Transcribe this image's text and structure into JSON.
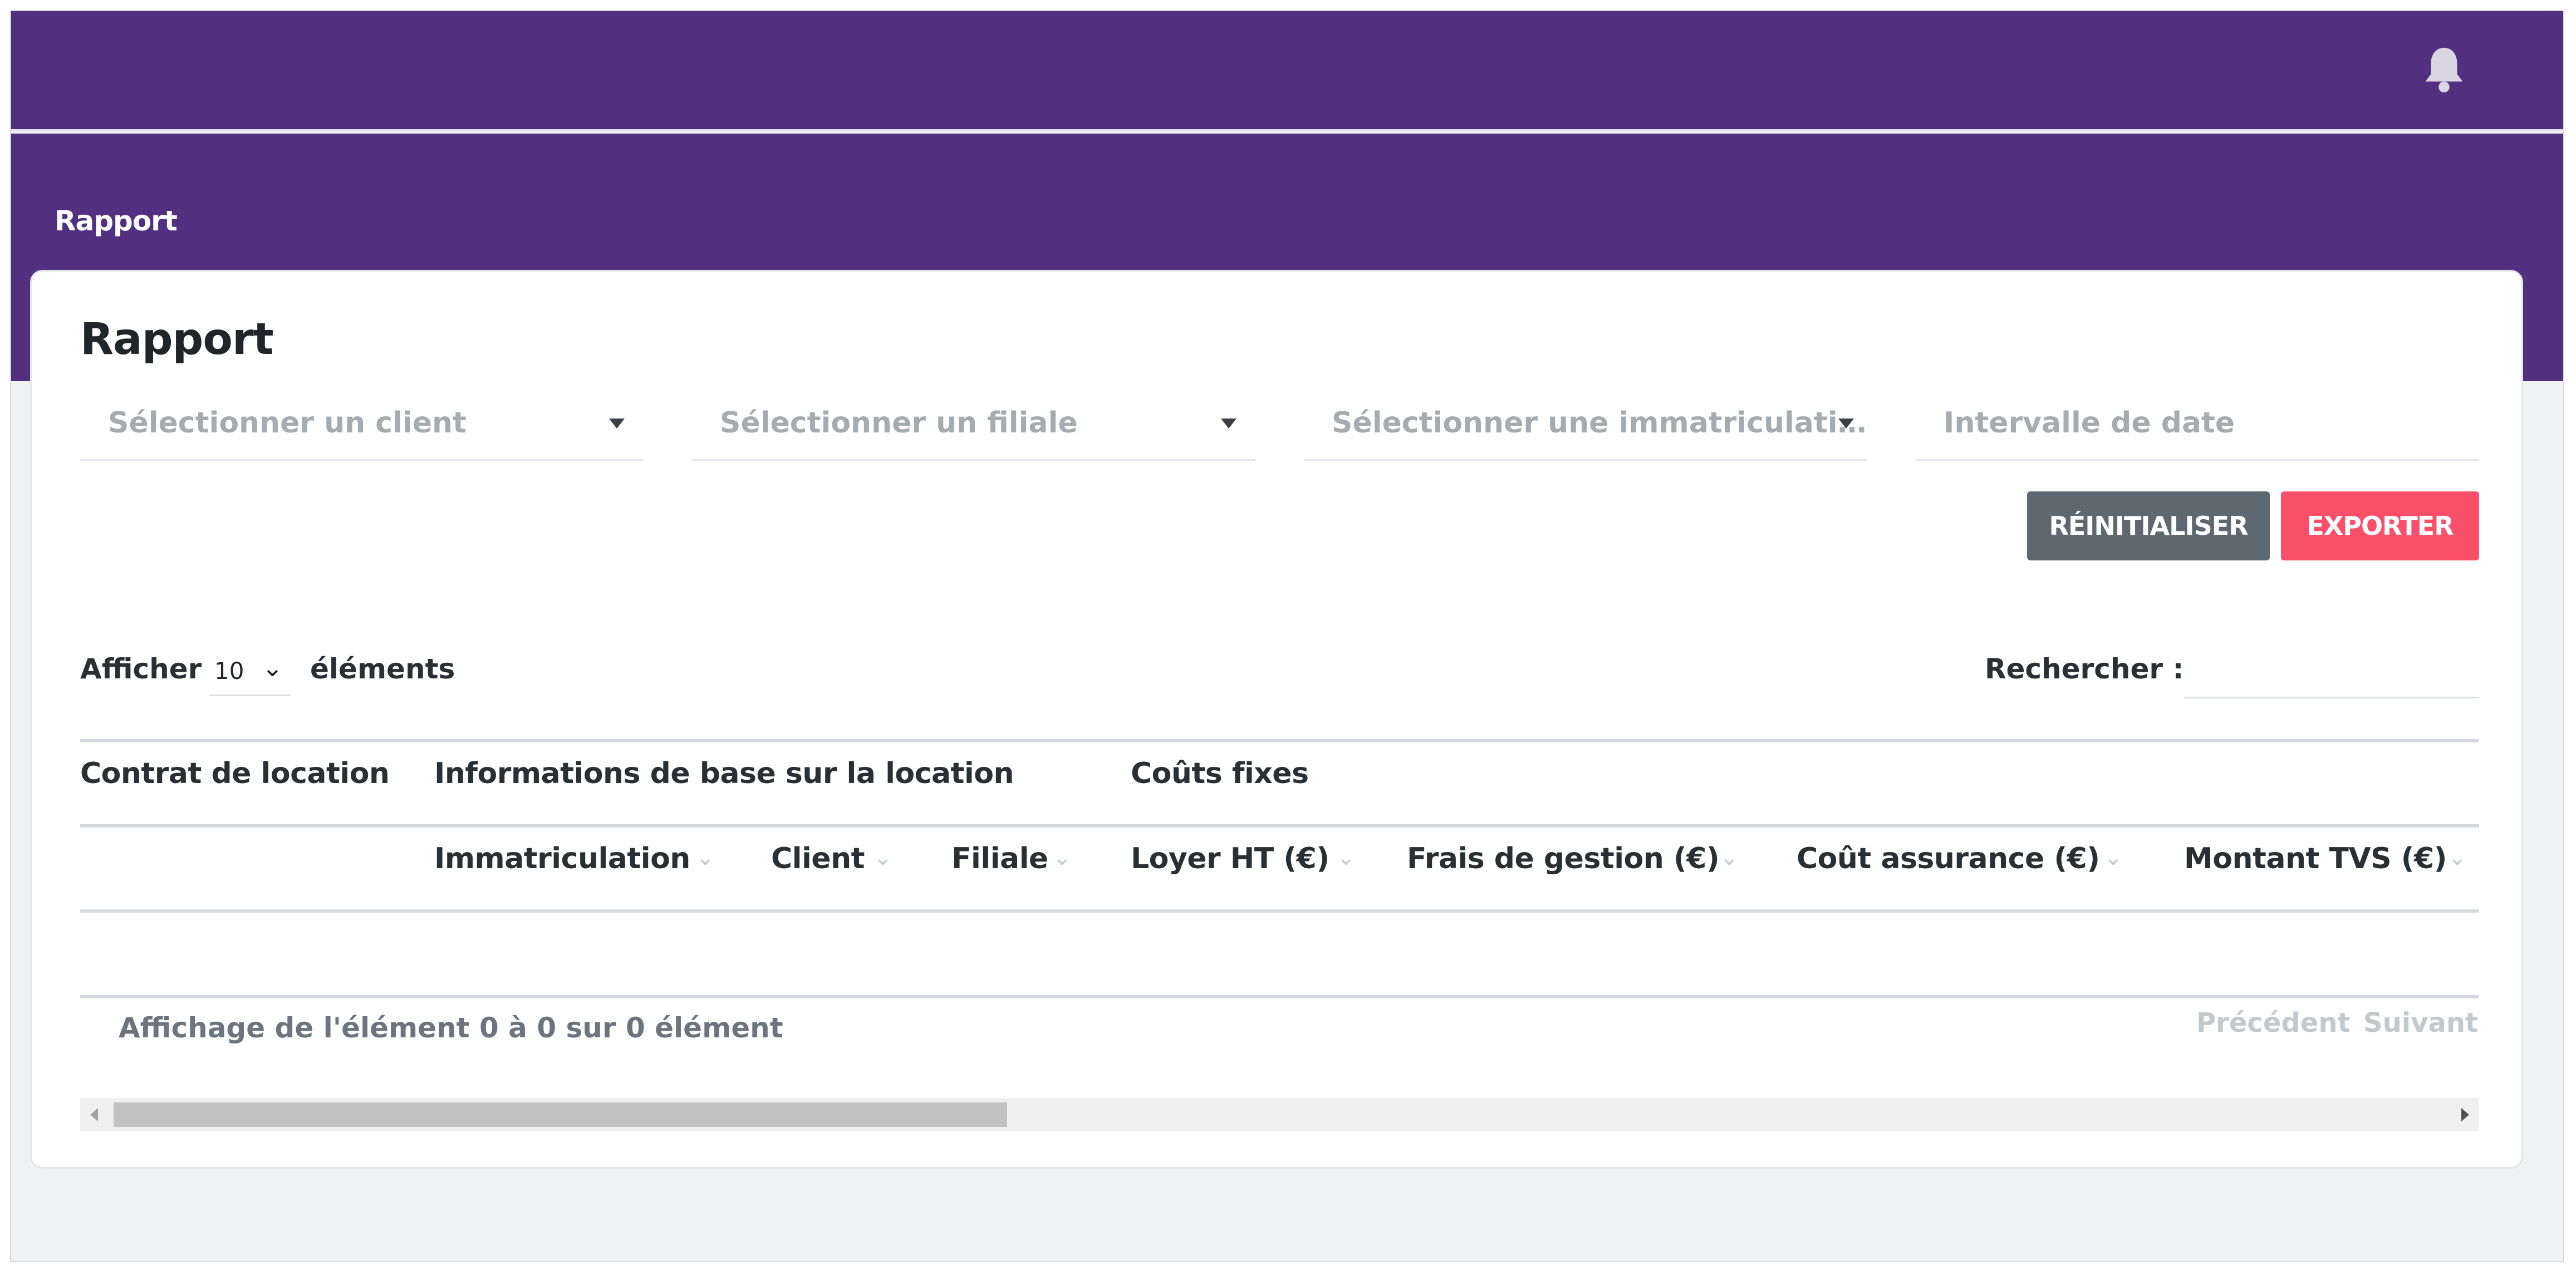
{
  "colors": {
    "brand_purple": "#53307f",
    "reset_button": "#5d6870",
    "export_button": "#f94f6a",
    "page_background": "#eff1f3"
  },
  "header": {
    "notification_icon": "bell-icon"
  },
  "breadcrumb": "Rapport",
  "page_title": "Rapport",
  "filters": {
    "client_placeholder": "Sélectionner un client",
    "filiale_placeholder": "Sélectionner un filiale",
    "immatriculation_placeholder": "Sélectionner une immatriculati…",
    "date_range_placeholder": "Intervalle de date"
  },
  "actions": {
    "reset_label": "RÉINITIALISER",
    "export_label": "EXPORTER"
  },
  "table_controls": {
    "show_label": "Afficher",
    "page_size": "10",
    "elements_label": "éléments",
    "search_label": "Rechercher :"
  },
  "table": {
    "group_headers": [
      "Contrat de location",
      "Informations de base sur la location",
      "Coûts fixes"
    ],
    "columns": [
      "Immatriculation",
      "Client",
      "Filiale",
      "Loyer HT (€)",
      "Frais de gestion (€)",
      "Coût assurance (€)",
      "Montant TVS (€)"
    ],
    "rows": []
  },
  "pagination": {
    "info": "Affichage de l'élément 0 à 0 sur 0 élément",
    "previous": "Précédent",
    "next": "Suivant"
  }
}
